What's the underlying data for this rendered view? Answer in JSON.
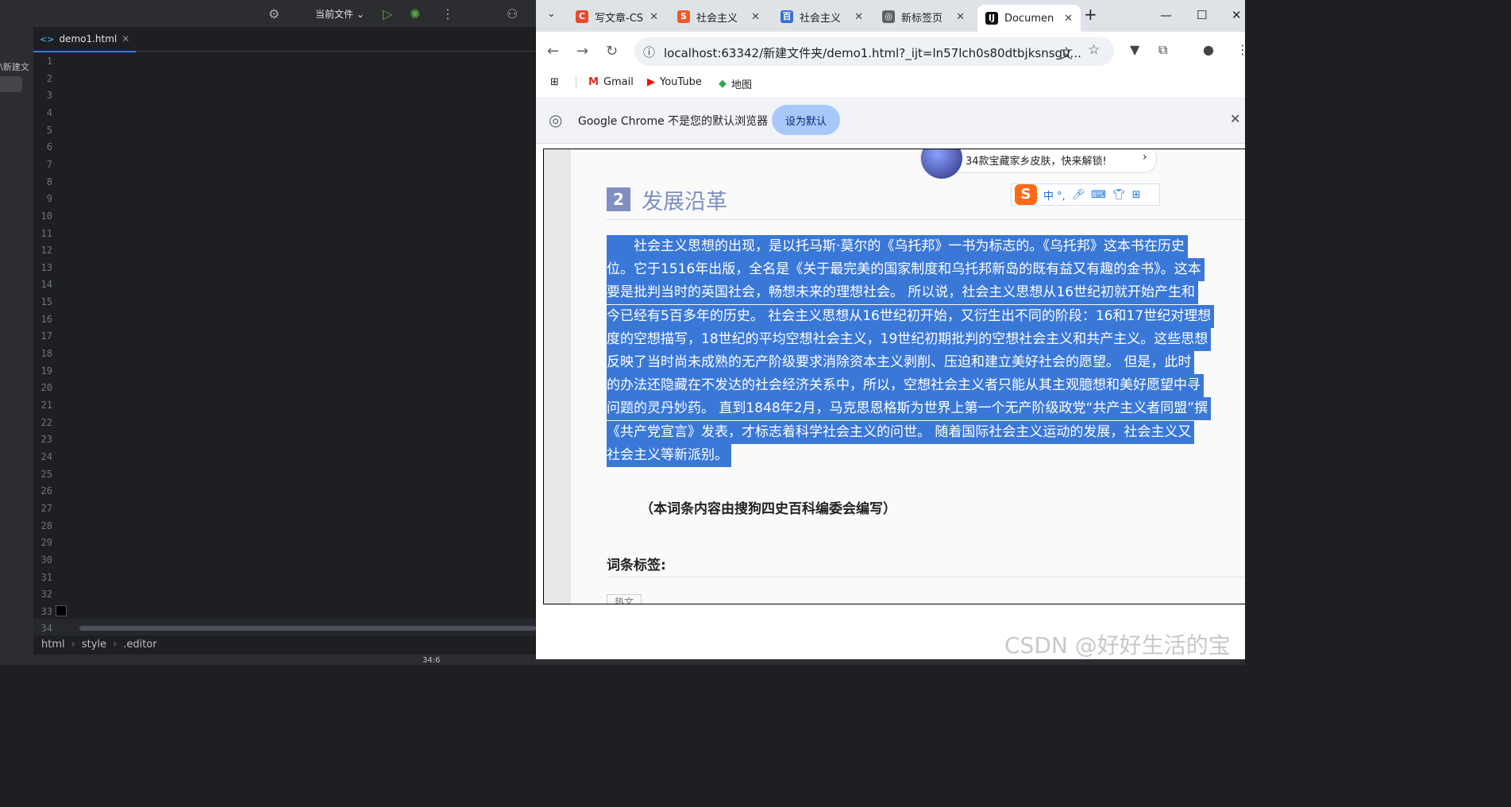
{
  "ide": {
    "run_config": "当前文件",
    "project_label": "\\新建文",
    "file_tab": "demo1.html",
    "line_numbers": [
      "1",
      "2",
      "3",
      "4",
      "5",
      "6",
      "7",
      "8",
      "9",
      "10",
      "11",
      "12",
      "13",
      "14",
      "15",
      "16",
      "17",
      "18",
      "19",
      "20",
      "21",
      "22",
      "23",
      "24",
      "25",
      "26",
      "27",
      "28",
      "29",
      "30",
      "31",
      "32",
      "33",
      "34"
    ],
    "breadcrumb": [
      "html",
      "style",
      ".editor"
    ],
    "cursor_pos": "34:6"
  },
  "chrome": {
    "tabs": [
      {
        "label": "写文章-CS",
        "icon": "csdn-icon",
        "color": "#e8492c",
        "glyph": "C"
      },
      {
        "label": "社会主义",
        "icon": "sogou-icon",
        "color": "#f05a28",
        "glyph": "S"
      },
      {
        "label": "社会主义",
        "icon": "baike-icon",
        "color": "#3b6fd4",
        "glyph": "百"
      },
      {
        "label": "新标签页",
        "icon": "chrome-icon",
        "color": "#5f6368",
        "glyph": "◎"
      },
      {
        "label": "Documen",
        "icon": "intellij-icon",
        "color": "#111111",
        "glyph": "IJ"
      }
    ],
    "url": "localhost:63342/新建文件夹/demo1.html?_ijt=ln57lch0s80dtbjksnsgu...",
    "bookmarks": [
      "Gmail",
      "YouTube",
      "地图"
    ],
    "infobar_text": "Google Chrome 不是您的默认浏览器",
    "set_default_label": "设为默认"
  },
  "page": {
    "section_number": "2",
    "section_title": "发展沿革",
    "ime_text": "中 °,",
    "ad_text": "34款宝藏家乡皮肤，快来解锁!",
    "paragraph_lines": [
      "　　社会主义思想的出现，是以托马斯·莫尔的《乌托邦》一书为标志的。《乌托邦》这本书在历史",
      "位。它于1516年出版，全名是《关于最完美的国家制度和乌托邦新岛的既有益又有趣的金书》。这本",
      "要是批判当时的英国社会，畅想未来的理想社会。 所以说，社会主义思想从16世纪初就开始产生和",
      "今已经有5百多年的历史。 社会主义思想从16世纪初开始，又衍生出不同的阶段：16和17世纪对理想",
      "度的空想描写，18世纪的平均空想社会主义，19世纪初期批判的空想社会主义和共产主义。这些思想",
      "反映了当时尚未成熟的无产阶级要求消除资本主义剥削、压迫和建立美好社会的愿望。 但是，此时",
      "的办法还隐藏在不发达的社会经济关系中，所以，空想社会主义者只能从其主观臆想和美好愿望中寻",
      "问题的灵丹妙药。 直到1848年2月，马克思恩格斯为世界上第一个无产阶级政党“共产主义者同盟”撰",
      "《共产党宣言》发表，才标志着科学社会主义的问世。 随着国际社会主义运动的发展，社会主义又",
      "社会主义等新派别。"
    ],
    "note": "（本词条内容由搜狗四史百科编委会编写）",
    "tag_label": "词条标签:",
    "tag_chip": "热文",
    "watermark": "CSDN @好好生活的宝"
  }
}
